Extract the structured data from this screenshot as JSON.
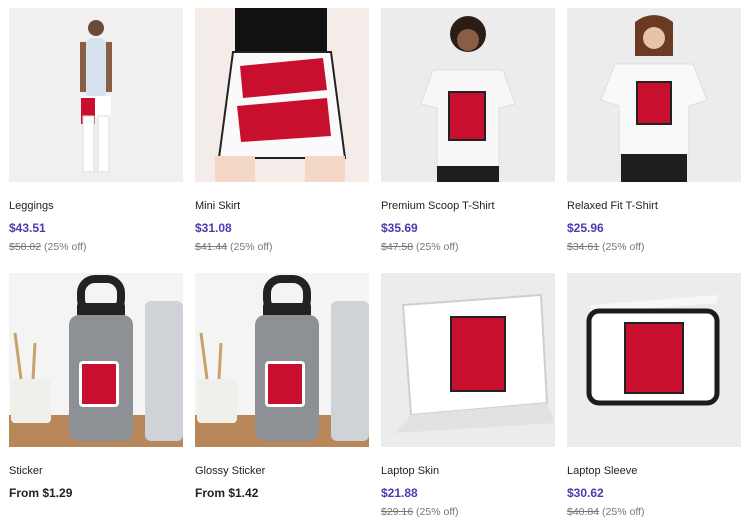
{
  "products": [
    {
      "name": "Leggings",
      "price": "$43.51",
      "original": "$58.02",
      "discount": "(25% off)",
      "icon": "leggings-image"
    },
    {
      "name": "Mini Skirt",
      "price": "$31.08",
      "original": "$41.44",
      "discount": "(25% off)",
      "icon": "mini-skirt-image"
    },
    {
      "name": "Premium Scoop T-Shirt",
      "price": "$35.69",
      "original": "$47.58",
      "discount": "(25% off)",
      "icon": "scoop-tshirt-image"
    },
    {
      "name": "Relaxed Fit T-Shirt",
      "price": "$25.96",
      "original": "$34.61",
      "discount": "(25% off)",
      "icon": "relaxed-tshirt-image"
    },
    {
      "name": "Sticker",
      "price": "From $1.29",
      "original": "",
      "discount": "",
      "icon": "sticker-image"
    },
    {
      "name": "Glossy Sticker",
      "price": "From $1.42",
      "original": "",
      "discount": "",
      "icon": "glossy-sticker-image"
    },
    {
      "name": "Laptop Skin",
      "price": "$21.88",
      "original": "$29.16",
      "discount": "(25% off)",
      "icon": "laptop-skin-image"
    },
    {
      "name": "Laptop Sleeve",
      "price": "$30.62",
      "original": "$40.84",
      "discount": "(25% off)",
      "icon": "laptop-sleeve-image"
    }
  ],
  "colors": {
    "sale_price": "#4a3bb0",
    "text": "#222222",
    "muted": "#777777",
    "design_red": "#c8102e"
  }
}
